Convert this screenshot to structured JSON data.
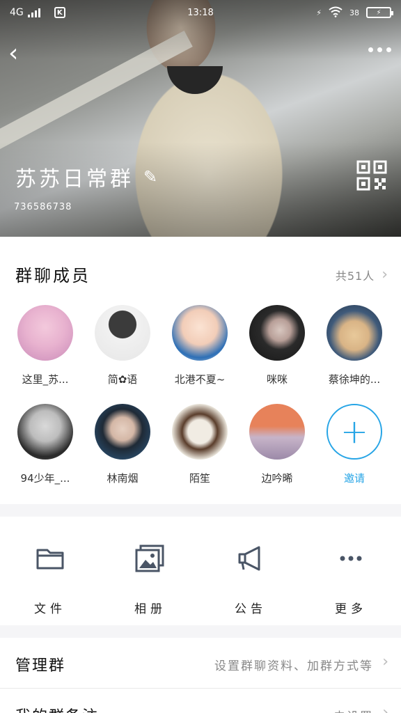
{
  "status_bar": {
    "network": "4G",
    "app_badge": "K",
    "time": "13:18",
    "battery_percent": "38"
  },
  "header": {
    "group_name": "苏苏日常群",
    "group_id": "736586738"
  },
  "members": {
    "title": "群聊成员",
    "count_label": "共51人",
    "list": [
      {
        "name": "这里_苏...",
        "color_a": "#f3c9dc",
        "color_b": "#c98ab8"
      },
      {
        "name": "简✿语",
        "color_a": "#e6e6e6",
        "color_b": "#3b3b3b"
      },
      {
        "name": "北港不夏~",
        "color_a": "#fbe3d3",
        "color_b": "#2d6fb6"
      },
      {
        "name": "咪咪",
        "color_a": "#2a2a2a",
        "color_b": "#d8c7c0"
      },
      {
        "name": "蔡徐坤的...",
        "color_a": "#3f5a7a",
        "color_b": "#e8c99a"
      },
      {
        "name": "94少年_...",
        "color_a": "#bdbdbd",
        "color_b": "#2a2a2a"
      },
      {
        "name": "林南烟",
        "color_a": "#2f5f8a",
        "color_b": "#e6d0c2"
      },
      {
        "name": "陌笙",
        "color_a": "#f1ece3",
        "color_b": "#5a3d2b"
      },
      {
        "name": "边吟晞",
        "color_a": "#e7825a",
        "color_b": "#9c8aa8"
      }
    ],
    "invite_label": "邀请"
  },
  "tools": [
    {
      "label": "文件",
      "icon": "folder-icon"
    },
    {
      "label": "相册",
      "icon": "album-icon"
    },
    {
      "label": "公告",
      "icon": "megaphone-icon"
    },
    {
      "label": "更多",
      "icon": "more-dots-icon"
    }
  ],
  "settings": {
    "manage_title": "管理群",
    "manage_hint": "设置群聊资料、加群方式等",
    "remark_title": "我的群备注",
    "remark_hint": "未设置"
  }
}
